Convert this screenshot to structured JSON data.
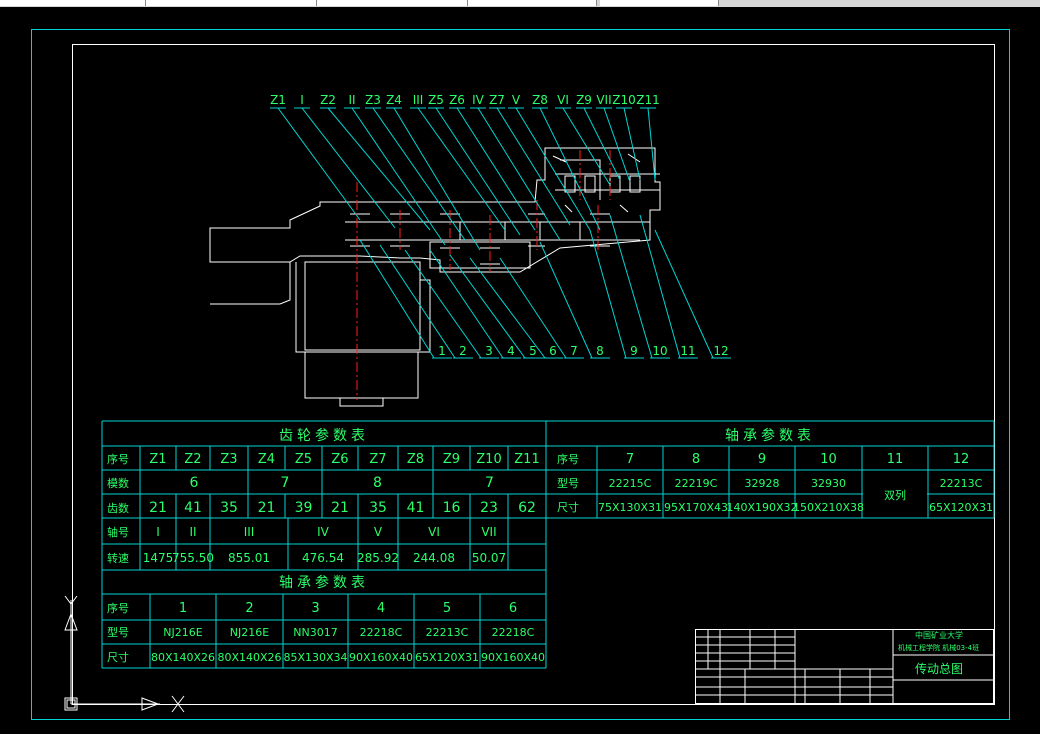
{
  "gear_labels": [
    "Z1",
    "I",
    "Z2",
    "II",
    "Z3",
    "Z4",
    "III",
    "Z5",
    "Z6",
    "IV",
    "Z7",
    "V",
    "Z8",
    "VI",
    "Z9",
    "VII",
    "Z10",
    "Z11"
  ],
  "part_numbers": [
    "1",
    "2",
    "3",
    "4",
    "5",
    "6",
    "7",
    "8",
    "9",
    "10",
    "11",
    "12"
  ],
  "gear_table": {
    "title": "齿轮参数表",
    "row_labels": [
      "序号",
      "模数",
      "齿数",
      "轴号",
      "转速"
    ],
    "gears": [
      "Z1",
      "Z2",
      "Z3",
      "Z4",
      "Z5",
      "Z6",
      "Z7",
      "Z8",
      "Z9",
      "Z10",
      "Z11"
    ],
    "modules": [
      "6",
      "7",
      "8",
      "7"
    ],
    "teeth": [
      "21",
      "41",
      "35",
      "21",
      "39",
      "21",
      "35",
      "41",
      "16",
      "23",
      "62"
    ],
    "shafts": [
      "I",
      "II",
      "III",
      "IV",
      "V",
      "VI",
      "VII"
    ],
    "speeds": [
      "1475",
      "755.50",
      "855.01",
      "476.54",
      "285.92",
      "244.08",
      "50.07"
    ]
  },
  "bearing_table_left": {
    "title": "轴承参数表",
    "row_labels": [
      "序号",
      "型号",
      "尺寸"
    ],
    "numbers": [
      "1",
      "2",
      "3",
      "4",
      "5",
      "6"
    ],
    "models": [
      "NJ216E",
      "NJ216E",
      "NN3017",
      "22218C",
      "22213C",
      "22218C"
    ],
    "sizes": [
      "80X140X26",
      "80X140X26",
      "85X130X34",
      "90X160X40",
      "65X120X31",
      "90X160X40"
    ]
  },
  "bearing_table_right": {
    "title": "轴承参数表",
    "row_labels": [
      "序号",
      "型号",
      "尺寸"
    ],
    "numbers": [
      "7",
      "8",
      "9",
      "10",
      "11",
      "12"
    ],
    "models": [
      "22215C",
      "22219C",
      "32928",
      "32930",
      "",
      "22213C"
    ],
    "merged_11": "双列",
    "sizes": [
      "75X130X31",
      "95X170X43",
      "140X190X32",
      "150X210X38",
      "",
      "65X120X31"
    ]
  },
  "title_block": {
    "school": "中国矿业大学",
    "subtitle": "机械工程学院 机械03-4班",
    "drawing_name": "传动总图"
  },
  "colors": {
    "border": "#00d5d5",
    "text": "#2bff6a",
    "outline": "#ffffff",
    "center": "#ff2020",
    "bg": "#000000"
  }
}
